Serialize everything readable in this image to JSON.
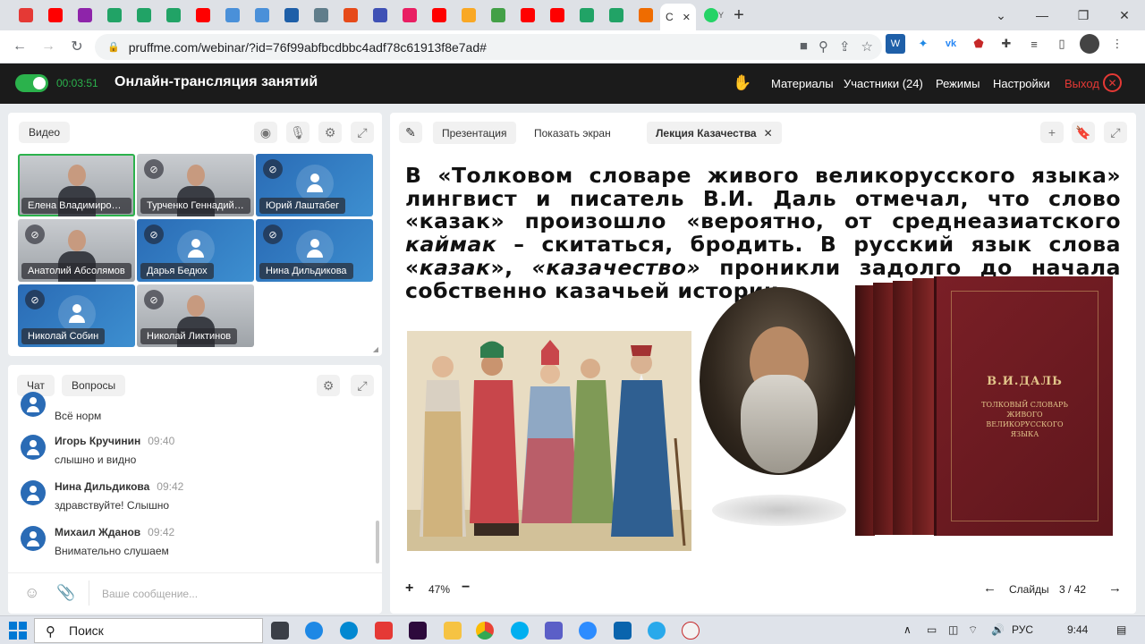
{
  "browser": {
    "tabs": [
      {
        "icon": "windows-icon",
        "color": "#e53935"
      },
      {
        "icon": "youtube-icon",
        "color": "#ff0000"
      },
      {
        "icon": "wb-icon",
        "color": "#8e24aa"
      },
      {
        "icon": "plus-green-icon",
        "color": "#21a366"
      },
      {
        "icon": "plus-green-icon",
        "color": "#21a366"
      },
      {
        "icon": "plus-green-icon",
        "color": "#21a366"
      },
      {
        "icon": "youtube-icon",
        "color": "#ff0000"
      },
      {
        "icon": "megaphone-icon",
        "color": "#4a90d9"
      },
      {
        "icon": "megaphone-icon",
        "color": "#4a90d9"
      },
      {
        "icon": "globe-icon",
        "color": "#1e5fa8"
      },
      {
        "icon": "gauge-icon",
        "color": "#607d8b"
      },
      {
        "icon": "c-red-icon",
        "color": "#e64a19"
      },
      {
        "icon": "triangle-icon",
        "color": "#3f51b5"
      },
      {
        "icon": "play-red-icon",
        "color": "#e91e63"
      },
      {
        "icon": "youtube-icon",
        "color": "#ff0000"
      },
      {
        "icon": "coin-icon",
        "color": "#f9a825"
      },
      {
        "icon": "bars-icon",
        "color": "#43a047"
      },
      {
        "icon": "youtube-icon",
        "color": "#ff0000"
      },
      {
        "icon": "youtube-icon",
        "color": "#ff0000"
      },
      {
        "icon": "plus-green-icon",
        "color": "#21a366"
      },
      {
        "icon": "plus-green-icon",
        "color": "#21a366"
      },
      {
        "icon": "m-icon",
        "color": "#ef6c00"
      }
    ],
    "active_tab_label": "C",
    "whatsapp_tab": "Y",
    "url": "pruffme.com/webinar/?id=76f99abfbcdbbc4adf78c61913f8e7ad#"
  },
  "header": {
    "timer": "00:03:51",
    "title": "Онлайн-трансляция занятий",
    "menu": [
      "Материалы",
      "Участники (24)",
      "Режимы",
      "Настройки"
    ],
    "exit": "Выход",
    "exit_color": "#e53935",
    "accent": "#2bb24c"
  },
  "video": {
    "tab_label": "Видео",
    "participants": [
      {
        "name": "Елена Владимировна",
        "type": "cam",
        "muted": false,
        "active": true
      },
      {
        "name": "Турченко Геннадий ...",
        "type": "cam",
        "muted": true,
        "active": false
      },
      {
        "name": "Юрий Лаштабег",
        "type": "blue",
        "muted": true,
        "active": false
      },
      {
        "name": "Анатолий Абсолямов",
        "type": "cam",
        "muted": true,
        "active": false
      },
      {
        "name": "Дарья Бедюх",
        "type": "blue",
        "muted": true,
        "active": false
      },
      {
        "name": "Нина Дильдикова",
        "type": "blue",
        "muted": true,
        "active": false
      },
      {
        "name": "Николай Собин",
        "type": "blue",
        "muted": true,
        "active": false
      },
      {
        "name": "Николай Ликтинов",
        "type": "cam",
        "muted": true,
        "active": false
      }
    ]
  },
  "chat": {
    "tabs": [
      "Чат",
      "Вопросы"
    ],
    "first_text": "Всё норм",
    "messages": [
      {
        "author": "Игорь Кручинин",
        "time": "09:40",
        "text": "слышно и видно"
      },
      {
        "author": "Нина Дильдикова",
        "time": "09:42",
        "text": "здравствуйте! Слышно"
      },
      {
        "author": "Михаил Жданов",
        "time": "09:42",
        "text": "Внимательно слушаем"
      }
    ],
    "placeholder": "Ваше сообщение..."
  },
  "presentation": {
    "tabs": [
      "Презентация",
      "Показать экран"
    ],
    "doc_tab": "Лекция Казачества",
    "slide_text": {
      "p1": "В «Толковом словаре живого великорусского языка» лингвист и писатель В.И. Даль отмечал, что слово «казак» произошло «вероятно, от среднеазиатского ",
      "i1": "каймак",
      "p2": " – скитаться, бродить. В русский язык слова «",
      "i2": "казак",
      "p3": "», ",
      "i3": "«казачество»",
      "p4": " проникли задолго до начала собственно казачьей истории."
    },
    "book": {
      "author": "В.И.ДАЛЬ",
      "title_lines": [
        "ТОЛКОВЫЙ СЛОВАРЬ",
        "ЖИВОГО",
        "ВЕЛИКОРУССКОГО",
        "ЯЗЫКА"
      ]
    },
    "zoom": "47%",
    "slides_label": "Слайды",
    "slide_current": "3",
    "slide_total": "42"
  },
  "taskbar": {
    "search": "Поиск",
    "lang": "РУС",
    "time": "9:44"
  }
}
